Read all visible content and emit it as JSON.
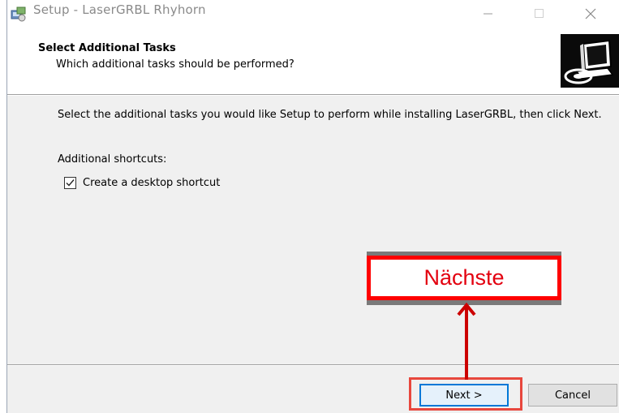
{
  "window": {
    "title": "Setup - LaserGRBL Rhyhorn"
  },
  "header": {
    "title": "Select Additional Tasks",
    "subtitle": "Which additional tasks should be performed?"
  },
  "content": {
    "description": "Select the additional tasks you would like Setup to perform while installing LaserGRBL, then click Next.",
    "shortcuts_label": "Additional shortcuts:",
    "desktop_shortcut": {
      "label": "Create a desktop shortcut",
      "checked": true
    }
  },
  "buttons": {
    "next_label": "Next >",
    "cancel_label": "Cancel"
  },
  "annotation": {
    "callout_text": "Nächste",
    "color": "#ff0000"
  },
  "icons": {
    "app": "setup-app-icon",
    "logo": "computer-disk-logo",
    "minimize": "minimize-icon",
    "maximize": "maximize-icon",
    "close": "close-icon",
    "checkmark": "checkmark-icon",
    "arrow": "arrow-up-icon"
  }
}
